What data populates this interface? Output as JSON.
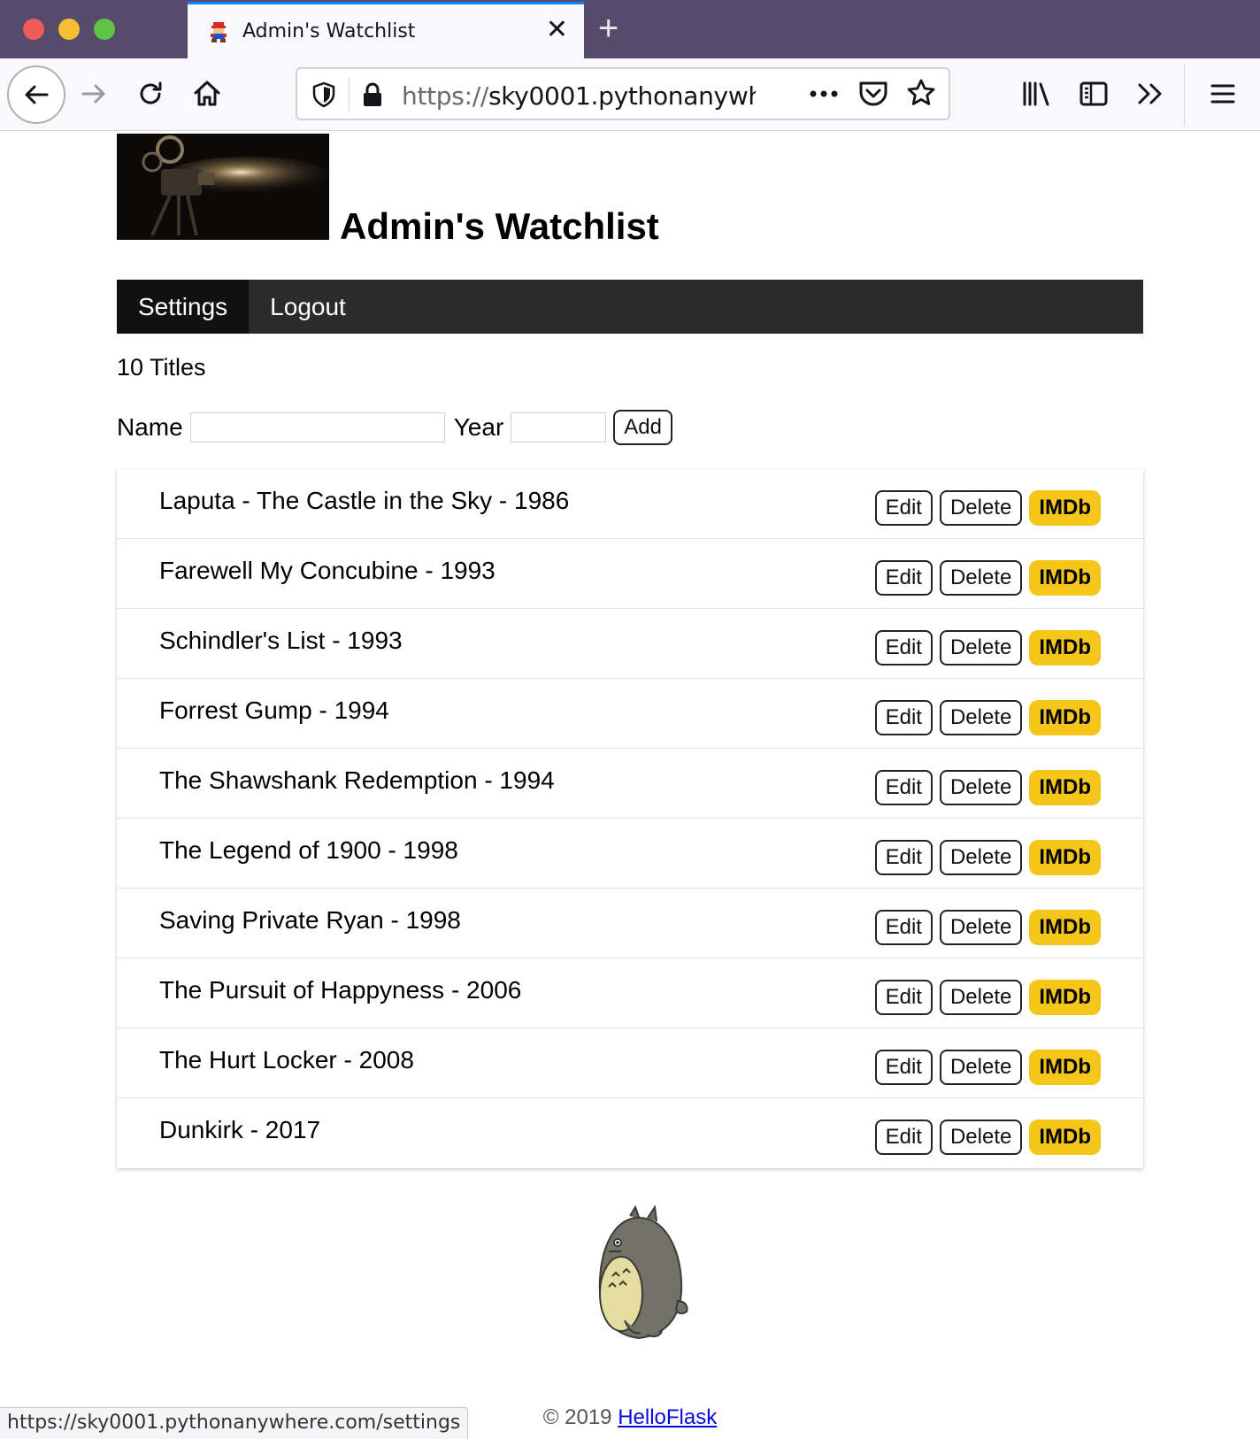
{
  "browser": {
    "tab_title": "Admin's Watchlist",
    "new_tab_glyph": "+",
    "url_scheme": "https://",
    "url_host": "sky0001.pythonanywhe",
    "status_url": "https://sky0001.pythonanywhere.com/settings",
    "icons": [
      "back-arrow-icon",
      "forward-arrow-icon",
      "reload-icon",
      "home-icon",
      "shield-icon",
      "lock-icon",
      "more-icon",
      "pocket-icon",
      "bookmark-star-icon",
      "library-icon",
      "sidebar-icon",
      "overflow-chevrons-icon",
      "hamburger-menu-icon"
    ]
  },
  "header": {
    "title": "Admin's Watchlist"
  },
  "menu": {
    "items": [
      {
        "label": "Settings",
        "active": true
      },
      {
        "label": "Logout",
        "active": false
      }
    ]
  },
  "summary": {
    "count_text": "10 Titles"
  },
  "form": {
    "name_label": "Name",
    "year_label": "Year",
    "name_value": "",
    "year_value": "",
    "add_label": "Add"
  },
  "movies": [
    {
      "text": "Laputa - The Castle in the Sky - 1986"
    },
    {
      "text": "Farewell My Concubine - 1993"
    },
    {
      "text": "Schindler's List - 1993"
    },
    {
      "text": "Forrest Gump - 1994"
    },
    {
      "text": "The Shawshank Redemption - 1994"
    },
    {
      "text": "The Legend of 1900 - 1998"
    },
    {
      "text": "Saving Private Ryan - 1998"
    },
    {
      "text": "The Pursuit of Happyness - 2006"
    },
    {
      "text": "The Hurt Locker - 2008"
    },
    {
      "text": "Dunkirk - 2017"
    }
  ],
  "actions": {
    "edit_label": "Edit",
    "delete_label": "Delete",
    "imdb_label": "IMDb"
  },
  "footer": {
    "copyright": "© 2019",
    "link_text": "HelloFlask"
  },
  "colors": {
    "tabbar": "#574a6b",
    "menu_bg": "#2b2b2b",
    "menu_active": "#111111",
    "imdb_yellow": "#f5c518",
    "link_blue": "#0b0bd6"
  }
}
